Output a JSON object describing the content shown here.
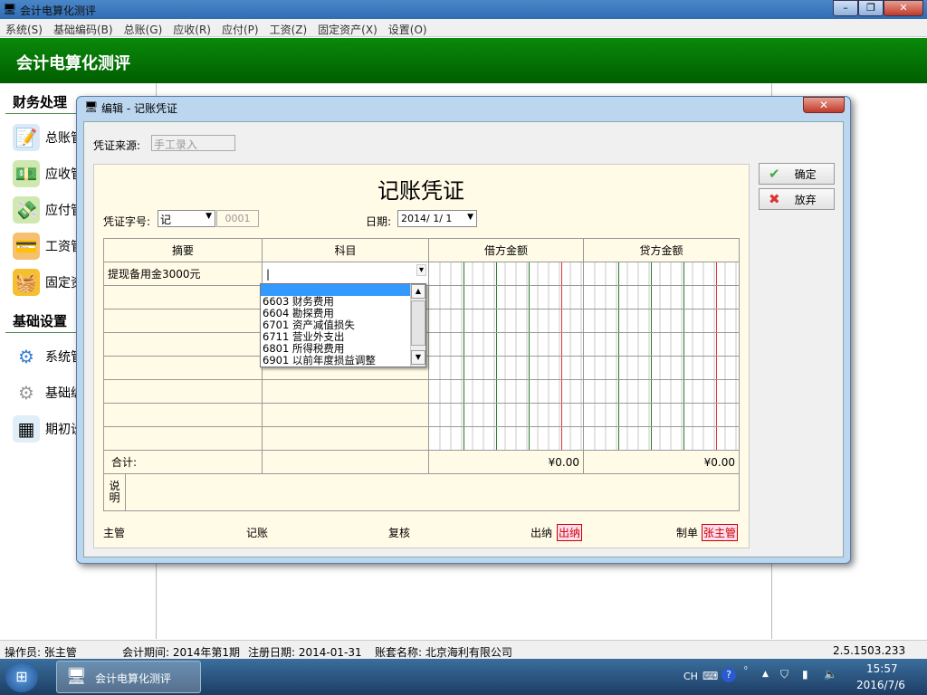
{
  "app": {
    "title": "会计电算化测评",
    "banner": "会计电算化测评"
  },
  "menu": [
    "系统(S)",
    "基础编码(B)",
    "总账(G)",
    "应收(R)",
    "应付(P)",
    "工资(Z)",
    "固定资产(X)",
    "设置(O)"
  ],
  "sidebar": {
    "section1": "财务处理",
    "items1": [
      {
        "label": "总账管",
        "icon": "notebook-pencil-icon"
      },
      {
        "label": "应收管",
        "icon": "cash-coins-icon"
      },
      {
        "label": "应付管",
        "icon": "cash-arrow-icon"
      },
      {
        "label": "工资管",
        "icon": "credit-card-icon"
      },
      {
        "label": "固定资",
        "icon": "basket-icon"
      }
    ],
    "section2": "基础设置",
    "items2": [
      {
        "label": "系统管",
        "icon": "gears-icon"
      },
      {
        "label": "基础编",
        "icon": "gear-icon"
      },
      {
        "label": "期初设",
        "icon": "table-coins-icon"
      }
    ]
  },
  "dialog": {
    "title": "编辑 - 记账凭证",
    "source_label": "凭证来源:",
    "source_value": "手工录入",
    "voucher_title": "记账凭证",
    "type_label": "凭证字号:",
    "type_value": "记",
    "number_value": "0001",
    "date_label": "日期:",
    "date_value": "2014/ 1/ 1",
    "ok": "确定",
    "cancel": "放弃",
    "columns": [
      "摘要",
      "科目",
      "借方金额",
      "贷方金额"
    ],
    "rows": [
      {
        "summary": "提现备用金3000元",
        "account": "|"
      }
    ],
    "total_label": "合计:",
    "debit_total": "¥0.00",
    "credit_total": "¥0.00",
    "note_label": "说明",
    "footer": {
      "supervisor": "主管",
      "bookkeeper": "记账",
      "reviewer": "复核",
      "cashier": "出纳",
      "cashier_stamp": "出纳",
      "preparer": "制单",
      "preparer_stamp": "张主管"
    },
    "account_options": [
      "",
      "6603  财务费用",
      "6604  勘探费用",
      "6701  资产减值损失",
      "6711  营业外支出",
      "6801  所得税费用",
      "6901  以前年度损益调整"
    ]
  },
  "status": {
    "operator": "操作员: 张主管",
    "period": "会计期间: 2014年第1期",
    "reg_date": "注册日期: 2014-01-31",
    "company": "账套名称: 北京海利有限公司",
    "version": "2.5.1503.233"
  },
  "taskbar": {
    "app": "会计电算化测评",
    "lang": "CH",
    "time": "15:57",
    "date": "2016/7/6"
  },
  "colors": {
    "banner": "#006e00",
    "highlight": "#3399ff",
    "stamp": "#cc0000"
  }
}
